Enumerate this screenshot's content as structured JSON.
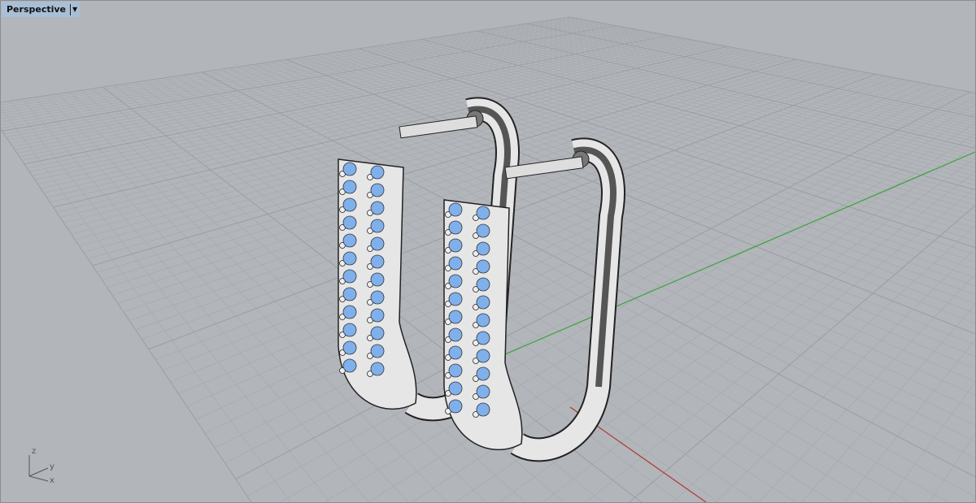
{
  "viewport": {
    "title": "Perspective",
    "menu_icon": "caret-down-icon",
    "axis_labels": {
      "z": "z",
      "y": "y",
      "x": "x"
    }
  },
  "colors": {
    "background": "#b2b5ba",
    "grid_minor": "#a6a9ae",
    "grid_major": "#9a9da2",
    "x_axis": "#b03a30",
    "y_axis": "#3aa33a",
    "gem": "#7fb0ec",
    "metal": "#e6e6e6"
  }
}
